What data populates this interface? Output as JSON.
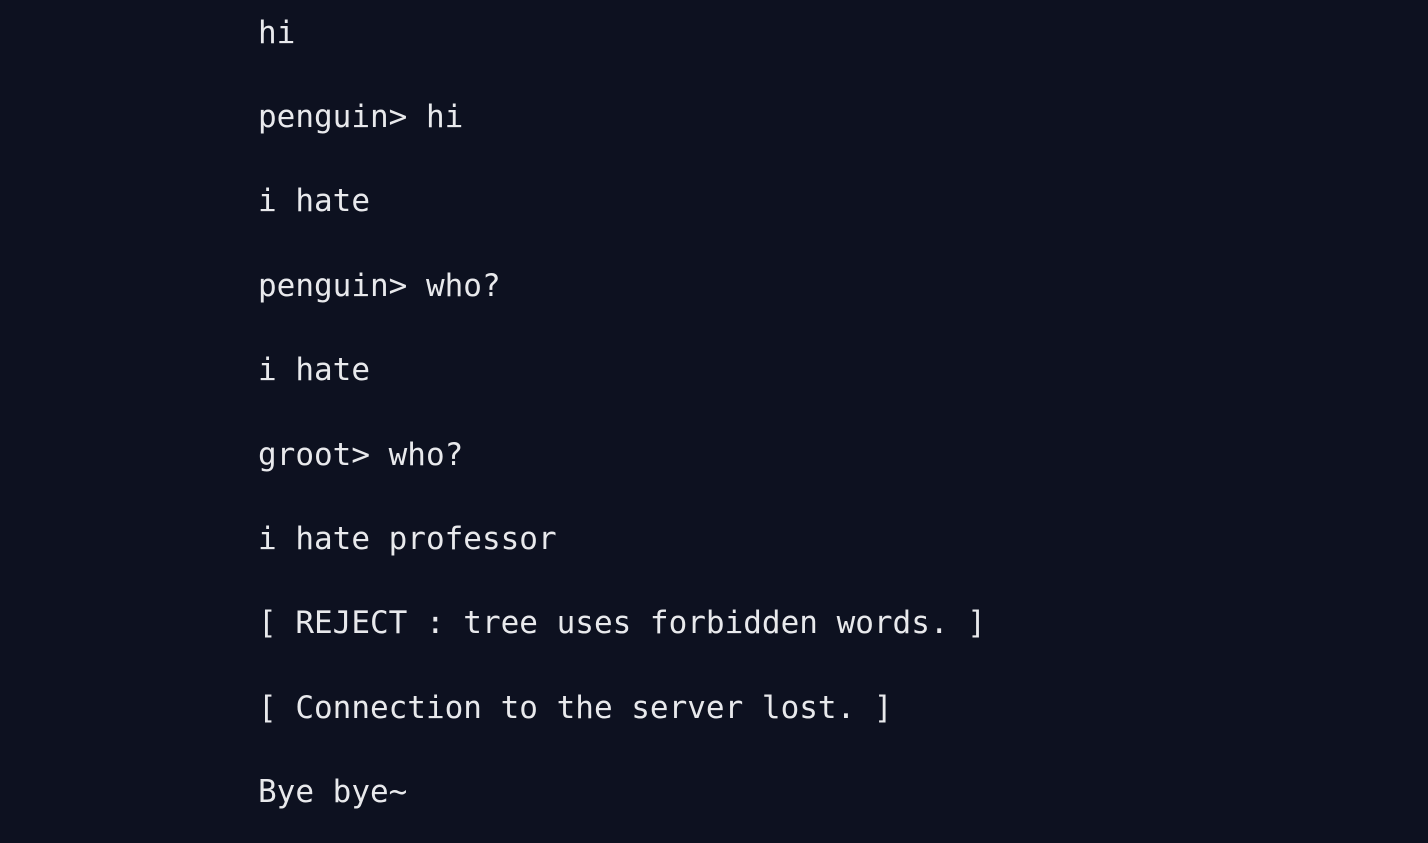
{
  "terminal": {
    "lines": [
      "hi",
      "penguin> hi",
      "i hate",
      "penguin> who?",
      "i hate",
      "groot> who?",
      "i hate professor",
      "[ REJECT : tree uses forbidden words. ]",
      "[ Connection to the server lost. ]",
      "Bye bye~"
    ],
    "colors": {
      "background": "#0d1120",
      "text": "#e8e9ec"
    }
  }
}
